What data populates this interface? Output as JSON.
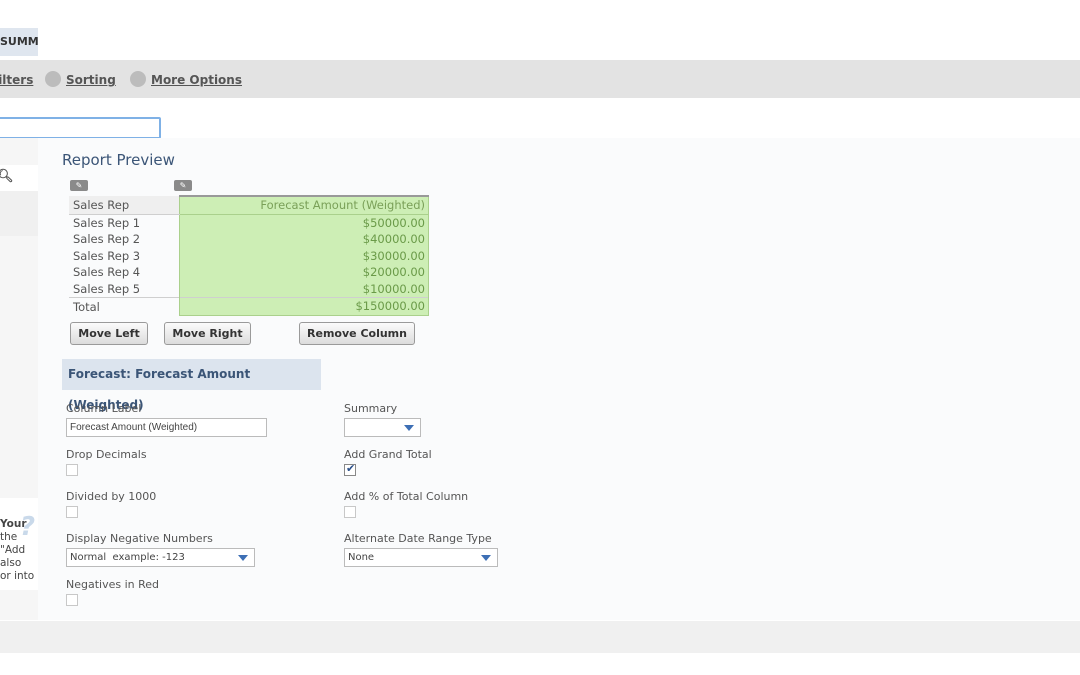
{
  "top_tab": {
    "label": "SUMMARY"
  },
  "nav": {
    "filters_label": "Filters",
    "sorting_label": "Sorting",
    "more_options_label": "More Options"
  },
  "search": {
    "value": ""
  },
  "left_panel": {
    "help_title": "Your",
    "help_line1": "the \"Add",
    "help_line2": "also",
    "help_line3": "or into"
  },
  "preview": {
    "title": "Report Preview",
    "header_rep": "Sales Rep",
    "header_amount": "Forecast Amount (Weighted)",
    "rows": [
      {
        "rep": "Sales Rep 1",
        "amount": "$50000.00"
      },
      {
        "rep": "Sales Rep 2",
        "amount": "$40000.00"
      },
      {
        "rep": "Sales Rep 3",
        "amount": "$30000.00"
      },
      {
        "rep": "Sales Rep 4",
        "amount": "$20000.00"
      },
      {
        "rep": "Sales Rep 5",
        "amount": "$10000.00"
      }
    ],
    "total_label": "Total",
    "total_amount": "$150000.00"
  },
  "buttons": {
    "move_left": "Move Left",
    "move_right": "Move Right",
    "remove_column": "Remove Column"
  },
  "section": {
    "title": "Forecast: Forecast Amount (Weighted)"
  },
  "form": {
    "column_label_label": "Column Label",
    "column_label_value": "Forecast Amount (Weighted)",
    "summary_label": "Summary",
    "summary_value": "",
    "drop_decimals_label": "Drop Decimals",
    "drop_decimals_checked": false,
    "add_grand_total_label": "Add Grand Total",
    "add_grand_total_checked": true,
    "divided_by_1000_label": "Divided by 1000",
    "divided_by_1000_checked": false,
    "add_pct_total_label": "Add % of Total Column",
    "add_pct_total_checked": false,
    "display_negative_label": "Display Negative Numbers",
    "display_negative_value": "Normal  example: -123",
    "alt_date_range_label": "Alternate Date Range Type",
    "alt_date_range_value": "None",
    "negatives_red_label": "Negatives in Red",
    "negatives_red_checked": false
  },
  "colors": {
    "accent": "#3b5577",
    "highlight_green": "#cdeeb5",
    "check_blue": "#2a4f8a"
  }
}
